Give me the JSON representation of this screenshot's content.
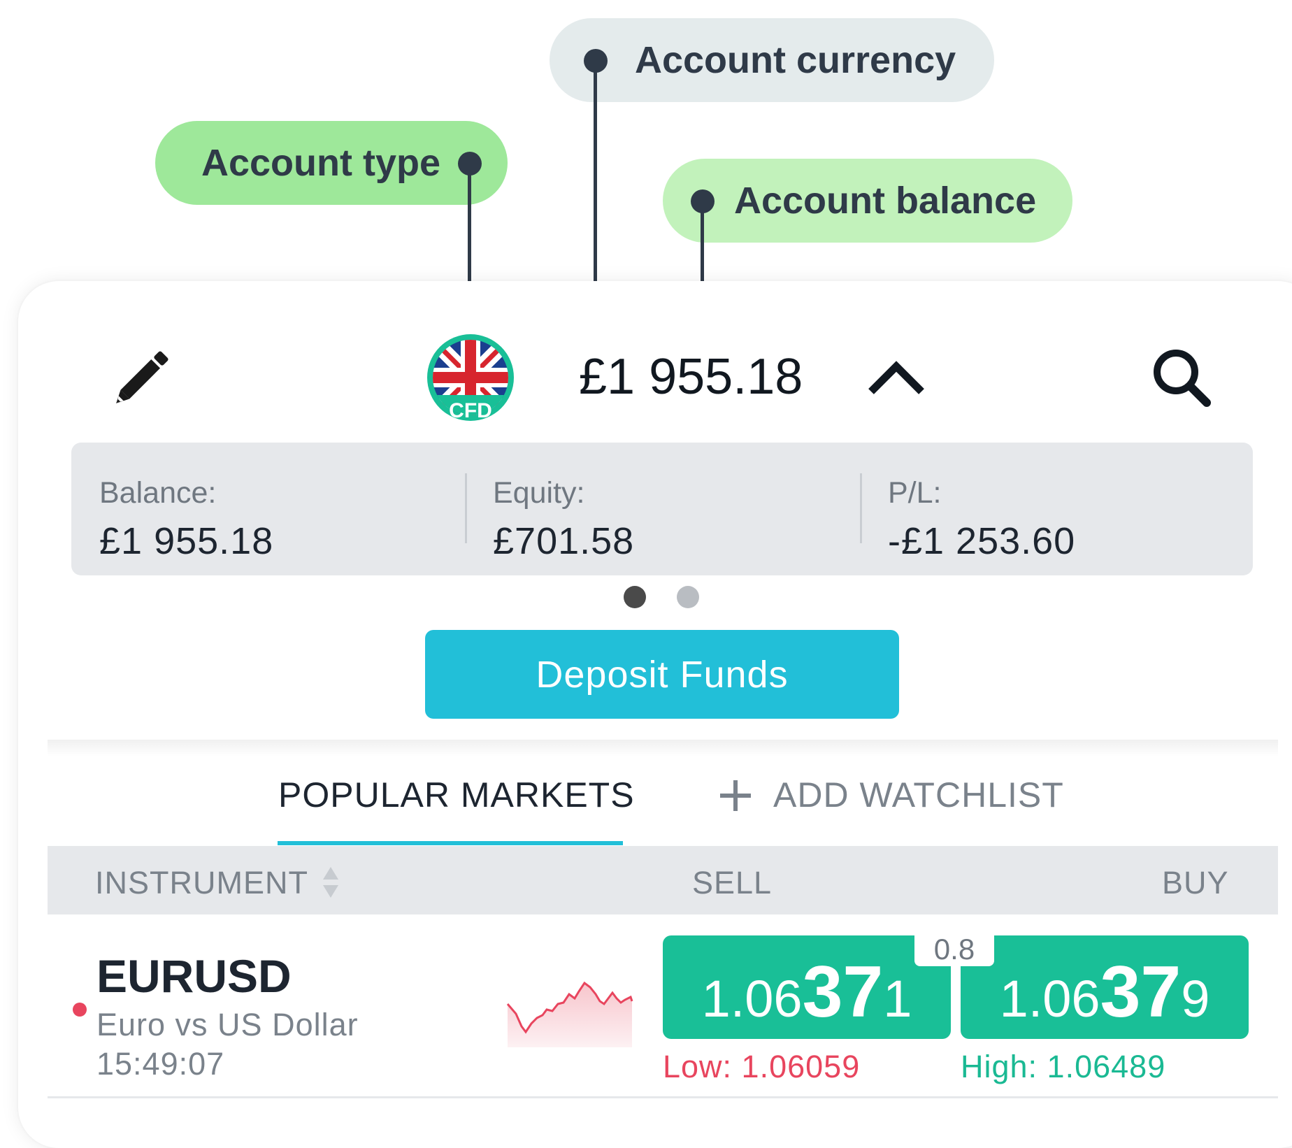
{
  "callouts": {
    "account_type": "Account type",
    "account_currency": "Account currency",
    "account_balance": "Account balance"
  },
  "header": {
    "account_badge_label": "CFD",
    "balance_display": "£1 955.18"
  },
  "summary": {
    "balance_label": "Balance:",
    "balance_value": "£1 955.18",
    "equity_label": "Equity:",
    "equity_value": "£701.58",
    "pl_label": "P/L:",
    "pl_value": "-£1 253.60"
  },
  "pager": {
    "count": 2,
    "active": 1
  },
  "deposit_button": "Deposit Funds",
  "tabs": {
    "popular": "POPULAR MARKETS",
    "add_watchlist": "ADD WATCHLIST"
  },
  "columns": {
    "instrument": "INSTRUMENT",
    "sell": "SELL",
    "buy": "BUY"
  },
  "market_row": {
    "symbol": "EURUSD",
    "name": "Euro vs US Dollar",
    "time": "15:49:07",
    "spread": "0.8",
    "sell": {
      "prefix": "1.06",
      "big": "37",
      "suffix": "1"
    },
    "buy": {
      "prefix": "1.06",
      "big": "37",
      "suffix": "9"
    },
    "low": "Low: 1.06059",
    "high": "High: 1.06489"
  },
  "colors": {
    "accent": "#22bfd8",
    "price_green": "#19bf97",
    "low_red": "#e8455e",
    "high_green": "#1ab993",
    "callout_green_strong": "#9ee89a",
    "callout_green_light": "#c2f2bb",
    "callout_grey": "#e4ebec"
  },
  "icons": [
    "pencil-icon",
    "uk-flag-icon",
    "chevron-up-icon",
    "search-icon",
    "plus-icon",
    "sort-icon",
    "sparkline-chart"
  ]
}
